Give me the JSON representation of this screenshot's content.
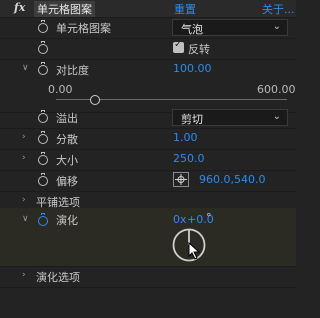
{
  "header": {
    "fx_icon": "fx",
    "effect_name": "单元格图案",
    "reset_label": "重置",
    "about_label": "关于..."
  },
  "rows": {
    "pattern": {
      "label": "单元格图案",
      "value": "气泡"
    },
    "invert": {
      "label": "反转",
      "checked": true
    },
    "contrast": {
      "label": "对比度",
      "value": "100.00",
      "slider_min": "0.00",
      "slider_max": "600.00",
      "slider_fraction": 0.1667
    },
    "overflow": {
      "label": "溢出",
      "value": "剪切"
    },
    "disperse": {
      "label": "分散",
      "value": "1.00"
    },
    "size": {
      "label": "大小",
      "value": "250.0"
    },
    "offset": {
      "label": "偏移",
      "value": "960.0,540.0"
    },
    "tiling": {
      "label": "平铺选项"
    },
    "evolution": {
      "label": "演化",
      "revolutions": "0x",
      "degrees": "+0.0",
      "degree_symbol": "°",
      "dial_angle_deg": 0
    },
    "evolution_options": {
      "label": "演化选项"
    }
  },
  "colors": {
    "accent_blue": "#2d8ceb",
    "panel_bg": "#232323",
    "evolution_bg": "#2b2b23"
  },
  "icons": [
    "fx-icon",
    "stopwatch-icon",
    "chevron-right-icon",
    "chevron-down-icon",
    "crosshair-icon",
    "dropdown-arrow-icon",
    "checkbox-icon",
    "angle-dial-icon",
    "mouse-pointer-icon"
  ]
}
